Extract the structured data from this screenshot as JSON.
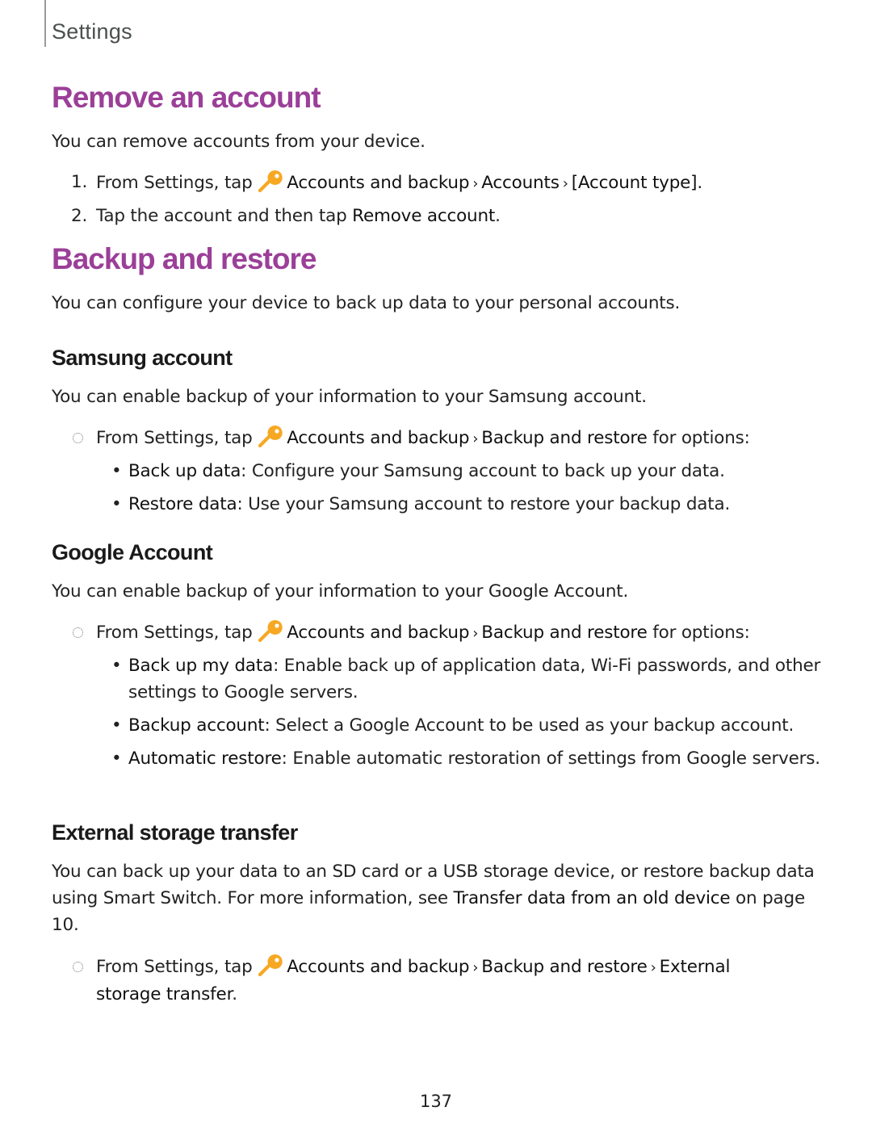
{
  "running_head": "Settings",
  "colors": {
    "heading_accent": "#9b3f98",
    "key_icon": "#f7a823"
  },
  "icons": {
    "accounts_icon": "key-icon",
    "chevron": "chevron-right-icon",
    "step_bullet": "dotted-circle-icon"
  },
  "remove_account": {
    "title": "Remove an account",
    "intro": "You can remove accounts from your device.",
    "steps": [
      {
        "num": "1.",
        "prefix": "From Settings, tap",
        "path": [
          "Accounts and backup",
          "Accounts",
          "[Account type]"
        ],
        "suffix": "."
      },
      {
        "num": "2.",
        "prefix": "Tap the account and then tap",
        "target": "Remove account",
        "suffix": "."
      }
    ]
  },
  "backup_restore": {
    "title": "Backup and restore",
    "intro": "You can configure your device to back up data to your personal accounts.",
    "samsung": {
      "title": "Samsung account",
      "intro": "You can enable backup of your information to your Samsung account.",
      "step": {
        "prefix": "From Settings, tap",
        "path": [
          "Accounts and backup",
          "Backup and restore"
        ],
        "suffix": " for options:"
      },
      "options": [
        {
          "term": "Back up data",
          "desc": ": Configure your Samsung account to back up your data."
        },
        {
          "term": "Restore data",
          "desc": ": Use your Samsung account to restore your backup data."
        }
      ]
    },
    "google": {
      "title": "Google Account",
      "intro": "You can enable backup of your information to your Google Account.",
      "step": {
        "prefix": "From Settings, tap",
        "path": [
          "Accounts and backup",
          "Backup and restore"
        ],
        "suffix": " for options:"
      },
      "options": [
        {
          "term": "Back up my data",
          "desc": ": Enable back up of application data, Wi-Fi passwords, and other settings to Google servers."
        },
        {
          "term": "Backup account",
          "desc": ": Select a Google Account to be used as your backup account."
        },
        {
          "term": "Automatic restore",
          "desc": ": Enable automatic restoration of settings from Google servers."
        }
      ]
    },
    "external": {
      "title": "External storage transfer",
      "intro_a": "You can back up your data to an SD card or a USB storage device, or restore backup data using Smart Switch. For more information, see ",
      "intro_link": "Transfer data from an old device",
      "intro_b": " on page 10.",
      "step": {
        "prefix": "From Settings, tap",
        "path": [
          "Accounts and backup",
          "Backup and restore",
          "External storage transfer"
        ],
        "suffix": "."
      }
    }
  },
  "page_number": "137"
}
